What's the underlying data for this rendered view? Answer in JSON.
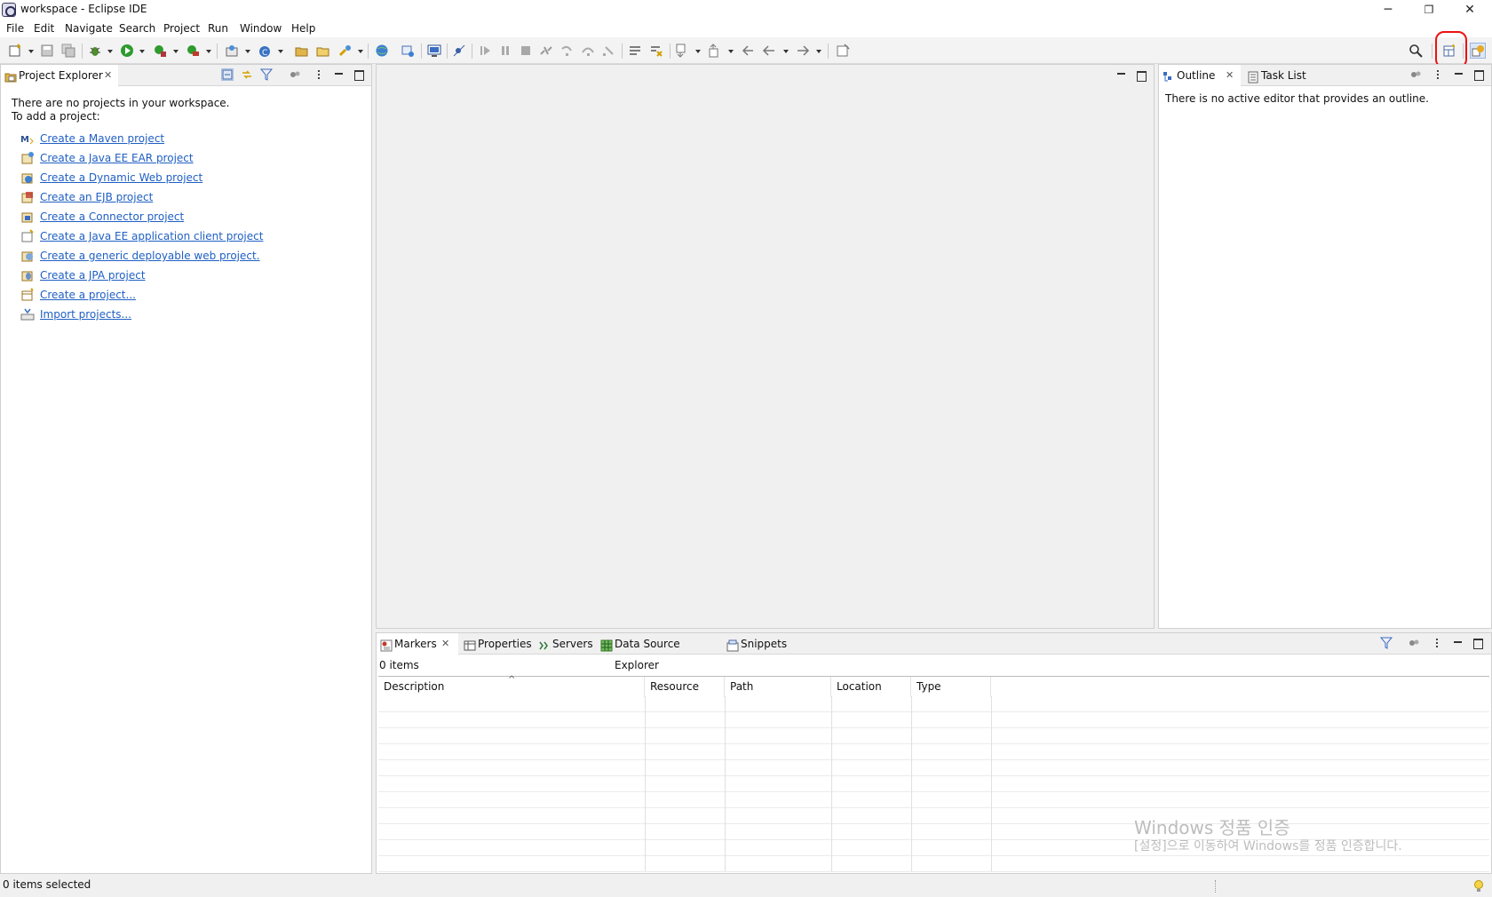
{
  "window": {
    "title": "workspace - Eclipse IDE",
    "minimize": "─",
    "restore": "❐",
    "close": "✕"
  },
  "menu": {
    "items": [
      "File",
      "Edit",
      "Navigate",
      "Search",
      "Project",
      "Run",
      "Window",
      "Help"
    ]
  },
  "toolbar": {
    "icons": [
      "new-icon",
      "save-icon",
      "save-all-icon",
      "debug-icon",
      "run-icon",
      "run-coverage-icon",
      "external-tools-icon",
      "new-server-icon",
      "new-java-class-icon",
      "open-type-icon",
      "open-task-icon",
      "search-tool-icon",
      "browser-icon",
      "open-web-service-icon",
      "open-console-icon",
      "skip-breakpoints-icon",
      "resume-icon",
      "suspend-icon",
      "terminate-icon",
      "disconnect-icon",
      "step-into-icon",
      "step-over-icon",
      "step-return-icon",
      "toggle-mark-occurrences-icon",
      "toggle-breadcrumb-icon",
      "next-annotation-icon",
      "previous-annotation-icon",
      "last-edit-location-icon",
      "back-icon",
      "forward-icon",
      "pin-editor-icon",
      "search-icon",
      "open-perspective-icon",
      "java-ee-perspective-icon"
    ],
    "accent_ring_color": "#e11111"
  },
  "project_explorer": {
    "tab_label": "Project Explorer",
    "empty_line1": "There are no projects in your workspace.",
    "empty_line2": "To add a project:",
    "links": [
      {
        "label": "Create a Maven project",
        "icon": "maven-icon"
      },
      {
        "label": "Create a Java EE EAR project",
        "icon": "ear-project-icon"
      },
      {
        "label": "Create a Dynamic Web project",
        "icon": "web-project-icon"
      },
      {
        "label": "Create an EJB project",
        "icon": "ejb-project-icon"
      },
      {
        "label": "Create a Connector project",
        "icon": "connector-project-icon"
      },
      {
        "label": "Create a Java EE application client project",
        "icon": "app-client-project-icon"
      },
      {
        "label": "Create a generic deployable web project.",
        "icon": "deployable-web-project-icon"
      },
      {
        "label": "Create a JPA project",
        "icon": "jpa-project-icon"
      },
      {
        "label": "Create a project...",
        "icon": "new-project-icon"
      },
      {
        "label": "Import projects...",
        "icon": "import-icon"
      }
    ],
    "link_color": "#1f5fc4"
  },
  "outline": {
    "tabs": [
      "Outline",
      "Task List"
    ],
    "message": "There is no active editor that provides an outline."
  },
  "bottom": {
    "tabs": [
      "Markers",
      "Properties",
      "Servers",
      "Data Source Explorer",
      "Snippets"
    ],
    "item_count": "0 items",
    "columns": [
      "Description",
      "Resource",
      "Path",
      "Location",
      "Type"
    ]
  },
  "status": {
    "text": "0 items selected"
  },
  "watermark": {
    "line1": "Windows 정품 인증",
    "line2": "[설정]으로 이동하여 Windows를 정품 인증합니다."
  }
}
